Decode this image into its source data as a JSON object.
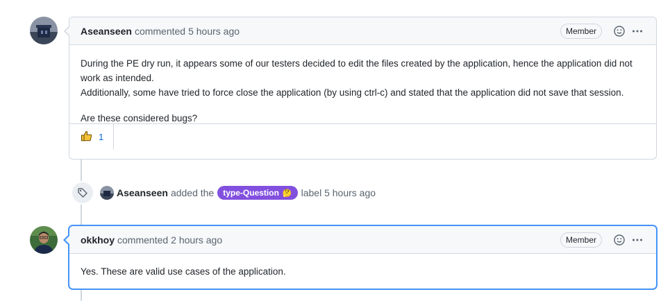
{
  "comment1": {
    "author": "Aseanseen",
    "action": "commented",
    "time": "5 hours ago",
    "badge": "Member",
    "body": [
      "During the PE dry run, it appears some of our testers decided to edit the files created by the application, hence the application did not work as intended.",
      "Additionally, some have tried to force close the application (by using ctrl-c) and stated that the application did not save that session.",
      "Are these considered bugs?"
    ],
    "reaction_count": "1",
    "reaction_icon": "thumbs-up-icon"
  },
  "event": {
    "actor": "Aseanseen",
    "verb": "added the",
    "label": "type-Question",
    "label_emoji": "🤔",
    "suffix": "label 5 hours ago",
    "label_color": "#8250df"
  },
  "comment2": {
    "author": "okkhoy",
    "action": "commented",
    "time": "2 hours ago",
    "badge": "Member",
    "body": [
      "Yes. These are valid use cases of the application."
    ]
  },
  "colors": {
    "accent": "#0969da",
    "highlight_border": "#4493f8",
    "border": "#d0d7de"
  }
}
